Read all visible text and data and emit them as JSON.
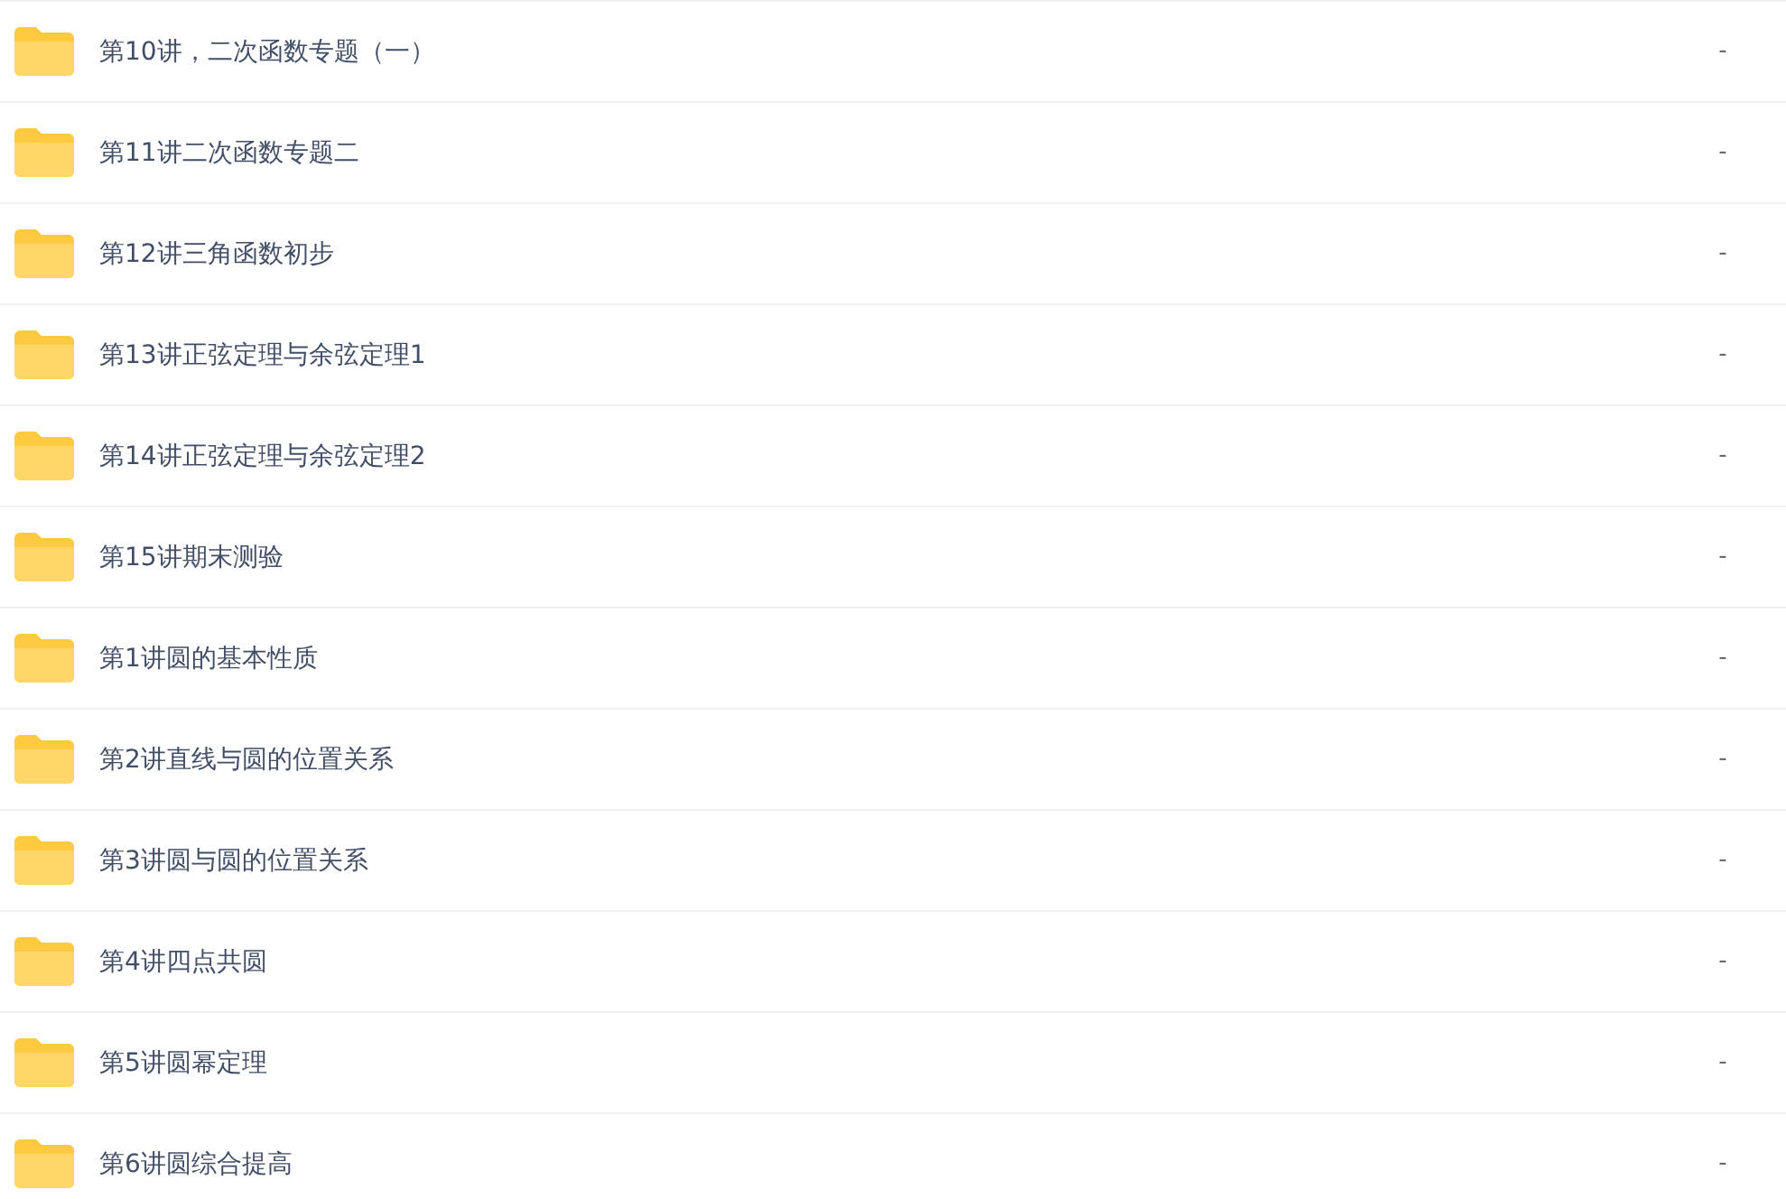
{
  "files": [
    {
      "name": "第10讲，二次函数专题（一）",
      "size": "-"
    },
    {
      "name": "第11讲二次函数专题二",
      "size": "-"
    },
    {
      "name": "第12讲三角函数初步",
      "size": "-"
    },
    {
      "name": "第13讲正弦定理与余弦定理1",
      "size": "-"
    },
    {
      "name": "第14讲正弦定理与余弦定理2",
      "size": "-"
    },
    {
      "name": "第15讲期末测验",
      "size": "-"
    },
    {
      "name": "第1讲圆的基本性质",
      "size": "-"
    },
    {
      "name": "第2讲直线与圆的位置关系",
      "size": "-"
    },
    {
      "name": "第3讲圆与圆的位置关系",
      "size": "-"
    },
    {
      "name": "第4讲四点共圆",
      "size": "-"
    },
    {
      "name": "第5讲圆幂定理",
      "size": "-"
    },
    {
      "name": "第6讲圆综合提高",
      "size": "-"
    }
  ]
}
